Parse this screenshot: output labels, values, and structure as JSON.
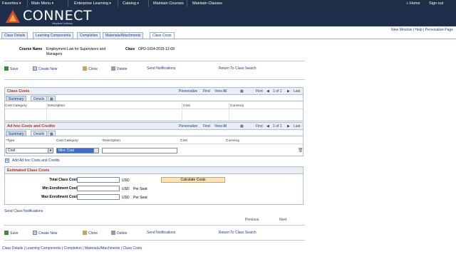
{
  "topnav": {
    "items": [
      "Favorites",
      "Main Menu",
      "Enterprise Learning",
      "Catalog",
      "Maintain Courses",
      "Maintain Classes"
    ],
    "home": "Home",
    "signout": "Sign out"
  },
  "banner": {
    "logo": "CONNECT",
    "sub": "Maryland Judiciary"
  },
  "toplinks": {
    "new_window": "New Window",
    "help": "Help",
    "personalize": "Personalize Page"
  },
  "tabs": [
    "Class Details",
    "Learning Components",
    "Completion",
    "Materials/Attachments",
    "Class Costs"
  ],
  "header": {
    "course_name_label": "Course Name",
    "course_name_value": "Employment Law for Supervisors and Managers",
    "class_label": "Class",
    "class_value": "OPD-1014-2015-12-09"
  },
  "toolbar": {
    "save": "Save",
    "create_new": "Create New",
    "clone": "Clone",
    "delete": "Delete",
    "send_notifications": "Send Notifications",
    "return": "Return To Class Search"
  },
  "class_costs": {
    "title": "Class Costs",
    "personalize": "Personalize",
    "find": "Find",
    "view_all": "View All",
    "first": "First",
    "count": "1 of 1",
    "last": "Last",
    "tabs": [
      "Summary",
      "Details"
    ],
    "columns": [
      "Cost Category",
      "Description",
      "Cost",
      "Currency"
    ]
  },
  "adhoc": {
    "title": "Ad hoc Costs and Credits",
    "personalize": "Personalize",
    "find": "Find",
    "view_all": "View All",
    "first": "First",
    "count": "1 of 1",
    "last": "Last",
    "tabs": [
      "Summary",
      "Details"
    ],
    "columns": [
      "*Type",
      "Cost Category",
      "*Description",
      "Cost",
      "Currency"
    ],
    "row": {
      "type": "Cost",
      "category": "Misc Cost"
    },
    "add_link": "Add Ad hoc Costs and Credits"
  },
  "estimated": {
    "title": "Estimated Class Costs",
    "rows": [
      {
        "label": "Total Class Cost",
        "unit": "USD",
        "extra": ""
      },
      {
        "label": "Min Enrollment Cost",
        "unit": "USD",
        "extra": "Per Seat"
      },
      {
        "label": "Max Enrollment Cost",
        "unit": "USD",
        "extra": "Per Seat"
      }
    ],
    "calculate": "Calculate Costs"
  },
  "send_class_notifications": "Send Class Notifications",
  "pager": {
    "previous": "Previous",
    "next": "Next"
  },
  "footer": "Class Details | Learning Components | Completion | Materials/Attachments | Class Costs",
  "colors": {
    "nav": "#1f2e45",
    "accent_red": "#b4321b",
    "link": "#1c3d87",
    "button": "#fbe3b8"
  }
}
